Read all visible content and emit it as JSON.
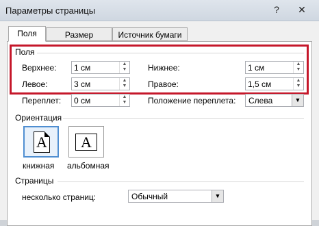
{
  "window": {
    "title": "Параметры страницы",
    "help": "?",
    "close": "✕"
  },
  "tabs": [
    {
      "label": "Поля",
      "active": true
    },
    {
      "label": "Размер бумаги",
      "active": false
    },
    {
      "label": "Источник бумаги",
      "active": false
    }
  ],
  "margins": {
    "group_label": "Поля",
    "top_label": "Верхнее:",
    "top_value": "1 см",
    "bottom_label": "Нижнее:",
    "bottom_value": "1 см",
    "left_label": "Левое:",
    "left_value": "3 см",
    "right_label": "Правое:",
    "right_value": "1,5 см",
    "gutter_label": "Переплет:",
    "gutter_value": "0 см",
    "gutter_pos_label": "Положение переплета:",
    "gutter_pos_value": "Слева"
  },
  "orientation": {
    "group_label": "Ориентация",
    "portrait_label": "книжная",
    "landscape_label": "альбомная",
    "glyph": "A"
  },
  "pages": {
    "group_label": "Страницы",
    "multiple_label": "несколько страниц:",
    "multiple_value": "Обычный"
  },
  "colors": {
    "highlight": "#c5172a",
    "selection": "#4f8ed1"
  }
}
